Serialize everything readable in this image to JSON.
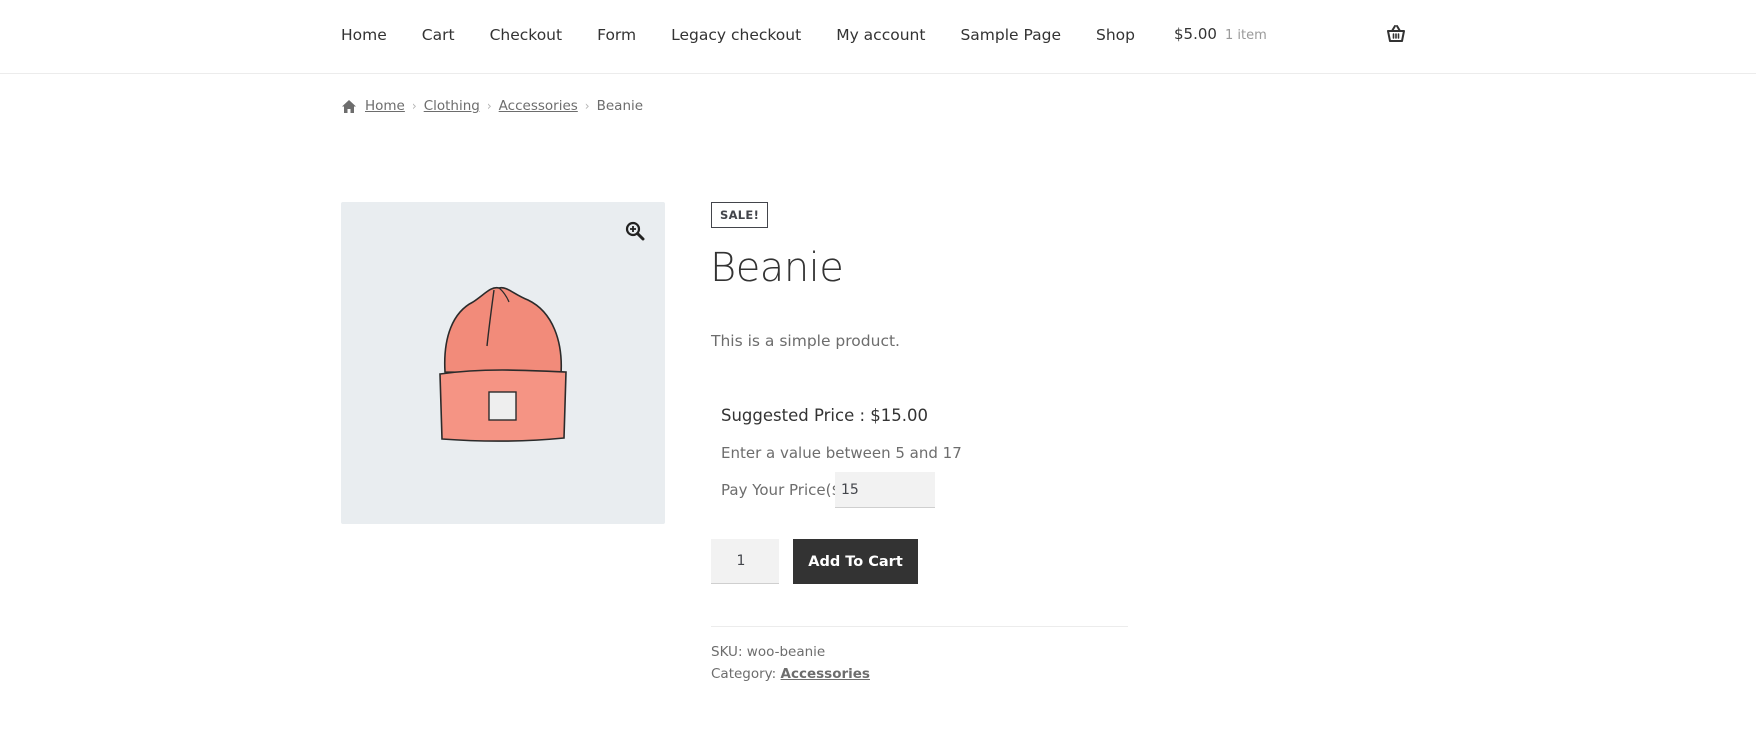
{
  "nav": {
    "items": [
      "Home",
      "Cart",
      "Checkout",
      "Form",
      "Legacy checkout",
      "My account",
      "Sample Page",
      "Shop"
    ]
  },
  "cart": {
    "amount": "$5.00",
    "count": "1 item",
    "icon": "basket-icon"
  },
  "breadcrumb": {
    "home_icon": "home-icon",
    "items": [
      "Home",
      "Clothing",
      "Accessories"
    ],
    "current": "Beanie"
  },
  "gallery": {
    "zoom_icon": "zoom-in-icon",
    "image": "beanie-product-image"
  },
  "product": {
    "badge": "SALE!",
    "title": "Beanie",
    "short_description": "This is a simple product.",
    "suggested_price": "Suggested Price : $15.00",
    "range_note": "Enter a value between 5 and 17",
    "pay_label": "Pay Your Price($)",
    "pay_value": "15",
    "quantity": "1",
    "add_to_cart": "Add To Cart",
    "sku_label": "SKU: woo-beanie",
    "category_label": "Category: ",
    "category": "Accessories"
  },
  "colors": {
    "button_bg": "#333333",
    "image_bg": "#e9edf0",
    "beanie": "#f08a78"
  }
}
